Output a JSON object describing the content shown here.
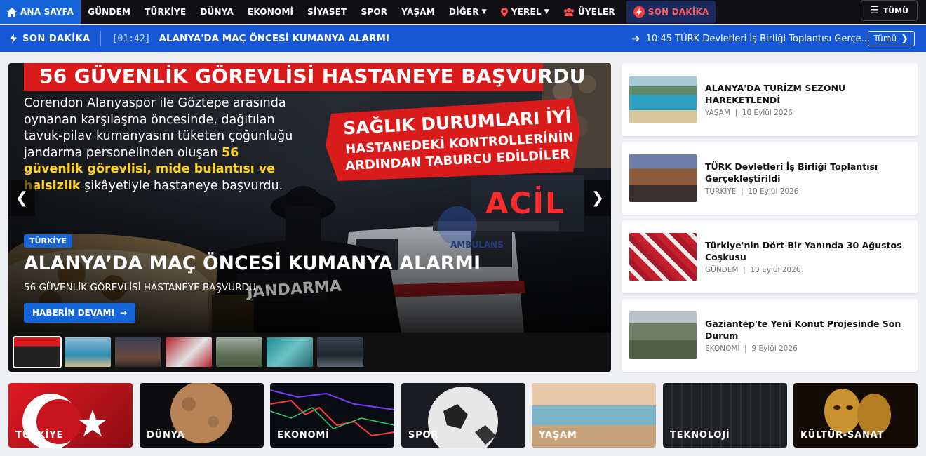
{
  "colors": {
    "nav_bg": "#101014",
    "accent": "#1565d8",
    "ticker_bg": "#1557d4",
    "breaking": "#ff5b5b"
  },
  "nav": {
    "items": [
      {
        "label": "ANA SAYFA",
        "icon": "home-icon"
      },
      {
        "label": "GÜNDEM"
      },
      {
        "label": "TÜRKİYE"
      },
      {
        "label": "DÜNYA"
      },
      {
        "label": "EKONOMİ"
      },
      {
        "label": "SİYASET"
      },
      {
        "label": "SPOR"
      },
      {
        "label": "YAŞAM"
      },
      {
        "label": "DİĞER",
        "icon": "chevron-down-icon"
      },
      {
        "label": "YEREL",
        "icon": "map-pin-icon"
      },
      {
        "label": "ÜYELER",
        "icon": "users-icon"
      },
      {
        "label": "SON DAKİKA",
        "icon": "bolt-icon"
      }
    ],
    "all_label": "TÜMÜ"
  },
  "ticker": {
    "label": "SON DAKİKA",
    "time": "[01:42]",
    "title": "ALANYA'DA MAÇ ÖNCESİ KUMANYA ALARMI",
    "right_item": "10:45 TÜRK Devletleri İş Birliği Toplantısı Gerçe...",
    "all_label": "Tümü"
  },
  "hero": {
    "banner": "56 GÜVENLİK GÖREVLİSİ HASTANEYE BAŞVURDU",
    "body_plain": "Corendon Alanyaspor ile Göztepe arasında oynanan karşılaşma öncesinde, dağıtılan tavuk-pilav kumanyasını tüketen çoğunluğu jandarma personelinden oluşan",
    "body_highlight": "56 güvenlik görevlisi, mide bulantısı ve halsizlik",
    "body_tail": "şikâyetiyle hastaneye başvurdu.",
    "red_line1": "SAĞLIK DURUMLARI İYİ",
    "red_line2": "HASTANEDEKİ KONTROLLERİNİN",
    "red_line3": "ARDINDAN TABURCU EDİLDİLER",
    "acil": "ACİL",
    "ambulance": "AMBULANS",
    "jandarma": "JANDARMA",
    "category": "TÜRKİYE",
    "title": "ALANYA’DA MAÇ ÖNCESİ KUMANYA ALARMI",
    "subtitle": "56 GÜVENLİK GÖREVLİSİ HASTANEYE BAŞVURDU",
    "cta": "HABERİN DEVAMI"
  },
  "side": [
    {
      "title": "ALANYA'DA TURİZM SEZONU HAREKETLENDİ",
      "category": "YAŞAM",
      "date": "10 Eylül 2026"
    },
    {
      "title": "TÜRK Devletleri İş Birliği Toplantısı Gerçekleştirildi",
      "category": "TÜRKİYE",
      "date": "10 Eylül 2026"
    },
    {
      "title": "Türkiye'nin Dört Bir Yanında 30 Ağustos Coşkusu",
      "category": "GÜNDEM",
      "date": "10 Eylül 2026"
    },
    {
      "title": "Gaziantep'te Yeni Konut Projesinde Son Durum",
      "category": "EKONOMİ",
      "date": "9 Eylül 2026"
    }
  ],
  "categories": [
    "TÜRKİYE",
    "DÜNYA",
    "EKONOMİ",
    "SPOR",
    "YAŞAM",
    "TEKNOLOJİ",
    "KÜLTÜR-SANAT"
  ]
}
